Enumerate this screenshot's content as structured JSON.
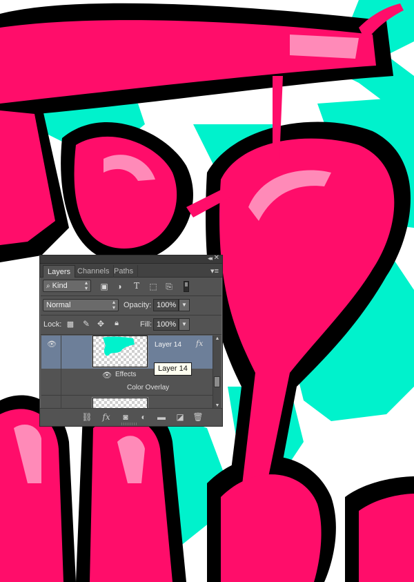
{
  "colors": {
    "pink": "#ff0d6a",
    "pink_highlight": "#ff8ab8",
    "pink_dark": "#b0003e",
    "outline": "#000000",
    "cyan": "#00f2cc",
    "panel_bg": "#535353",
    "selection": "#6d7f99"
  },
  "panel": {
    "tabs": [
      {
        "label": "Layers",
        "active": true
      },
      {
        "label": "Channels",
        "active": false
      },
      {
        "label": "Paths",
        "active": false
      }
    ],
    "filter": {
      "kind_label": "Kind",
      "icons": [
        "image-filter-icon",
        "adjustment-filter-icon",
        "type-filter-icon",
        "shape-filter-icon",
        "smart-object-filter-icon",
        "filter-toggle-icon"
      ]
    },
    "blend": {
      "mode": "Normal",
      "opacity_label": "Opacity:",
      "opacity_value": "100%"
    },
    "lock": {
      "label": "Lock:",
      "icons": [
        "lock-transparent-icon",
        "lock-image-icon",
        "lock-position-icon",
        "lock-all-icon"
      ],
      "fill_label": "Fill:",
      "fill_value": "100%"
    },
    "layers": [
      {
        "name": "Layer 14",
        "selected": true,
        "fx": "fx",
        "visible": true
      },
      {
        "effects_label": "Effects",
        "effect": "Color Overlay"
      },
      {
        "name": "",
        "selected": false,
        "visible": false
      }
    ],
    "tooltip": "Layer 14",
    "bottom_icons": [
      "link-icon",
      "fx-icon",
      "mask-icon",
      "adjustment-icon",
      "folder-icon",
      "new-layer-icon",
      "trash-icon"
    ],
    "bottom_fx_label": "fx"
  }
}
